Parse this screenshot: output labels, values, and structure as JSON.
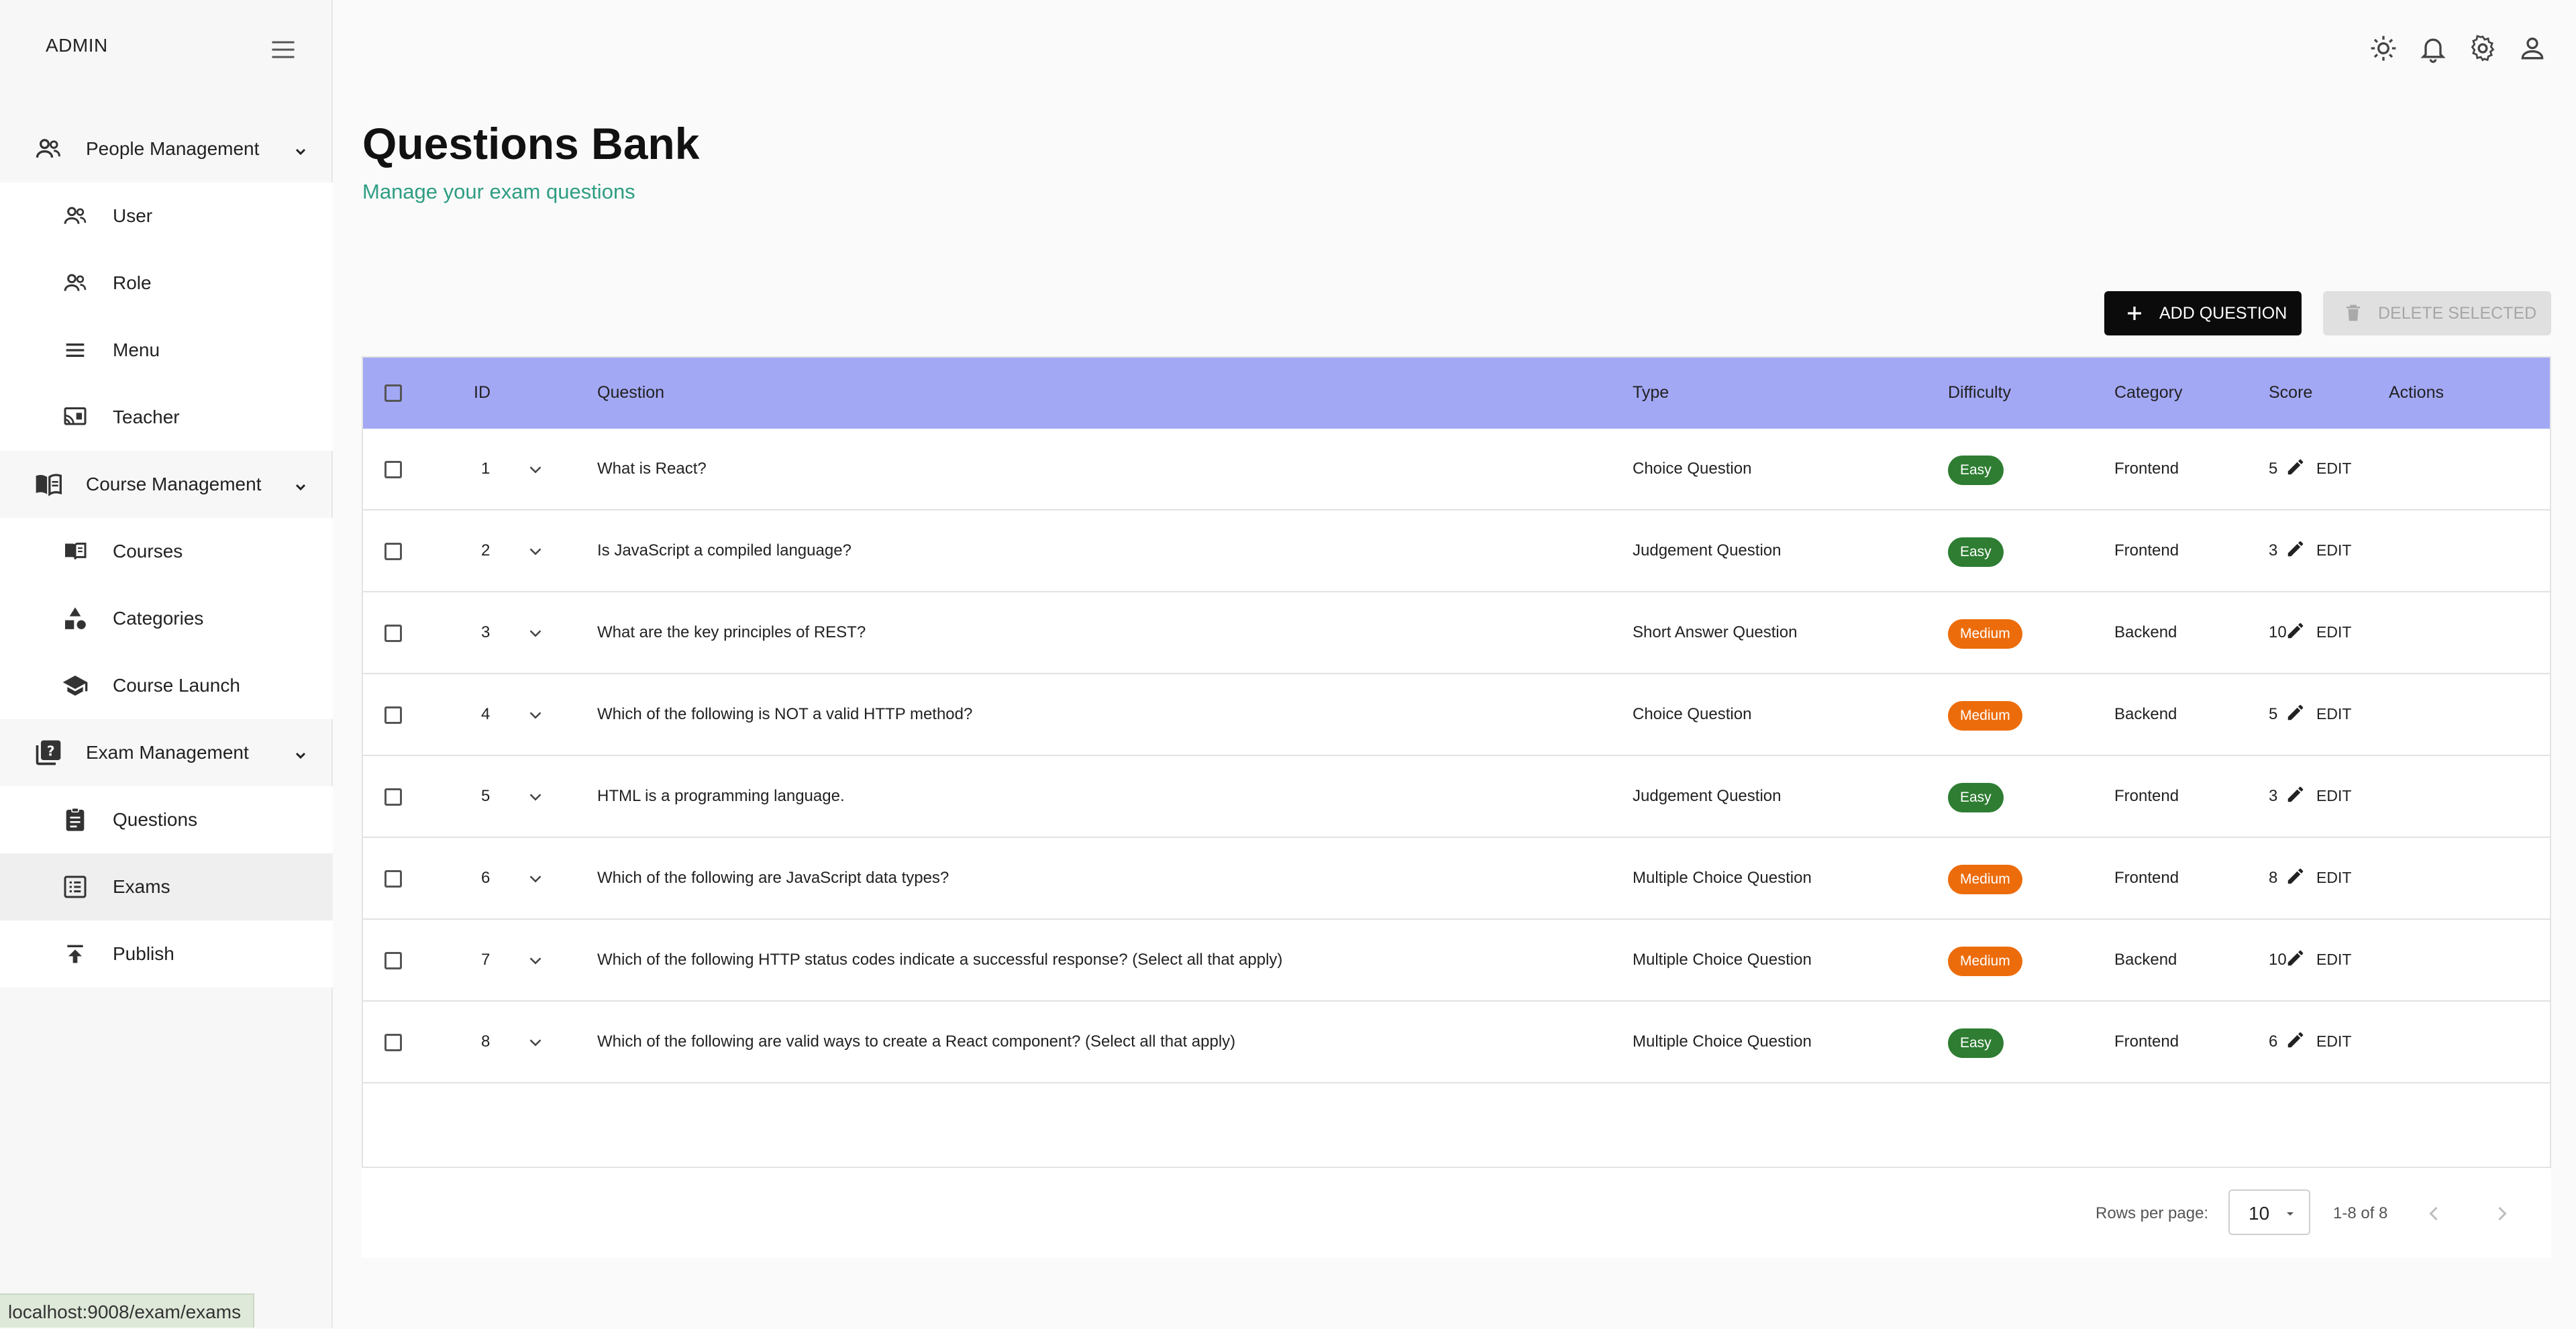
{
  "sidebar": {
    "brand": "ADMIN",
    "groups": [
      {
        "label": "People Management",
        "icon": "people-icon",
        "items": [
          {
            "label": "User",
            "icon": "people-icon"
          },
          {
            "label": "Role",
            "icon": "people-icon"
          },
          {
            "label": "Menu",
            "icon": "menu-lines-icon"
          },
          {
            "label": "Teacher",
            "icon": "cast-for-education-icon"
          }
        ]
      },
      {
        "label": "Course Management",
        "icon": "menu-book-icon",
        "items": [
          {
            "label": "Courses",
            "icon": "book-icon"
          },
          {
            "label": "Categories",
            "icon": "category-shapes-icon"
          },
          {
            "label": "Course Launch",
            "icon": "school-icon"
          }
        ]
      },
      {
        "label": "Exam Management",
        "icon": "quiz-icon",
        "items": [
          {
            "label": "Questions",
            "icon": "assignment-icon"
          },
          {
            "label": "Exams",
            "icon": "list-alt-icon"
          },
          {
            "label": "Publish",
            "icon": "publish-icon"
          }
        ]
      }
    ],
    "active_item": "Exams"
  },
  "topbar": {
    "icons": [
      "theme-sun-icon",
      "notifications-bell-icon",
      "settings-gear-icon",
      "account-person-icon"
    ]
  },
  "header": {
    "title": "Questions Bank",
    "subtitle": "Manage your exam questions"
  },
  "toolbar": {
    "add_label": "ADD QUESTION",
    "delete_label": "DELETE SELECTED"
  },
  "table": {
    "columns": [
      "ID",
      "Question",
      "Type",
      "Difficulty",
      "Category",
      "Score",
      "Actions"
    ],
    "edit_label": "EDIT",
    "rows": [
      {
        "id": "1",
        "question": "What is React?",
        "type": "Choice Question",
        "difficulty": "Easy",
        "category": "Frontend",
        "score": "5"
      },
      {
        "id": "2",
        "question": "Is JavaScript a compiled language?",
        "type": "Judgement Question",
        "difficulty": "Easy",
        "category": "Frontend",
        "score": "3"
      },
      {
        "id": "3",
        "question": "What are the key principles of REST?",
        "type": "Short Answer Question",
        "difficulty": "Medium",
        "category": "Backend",
        "score": "10"
      },
      {
        "id": "4",
        "question": "Which of the following is NOT a valid HTTP method?",
        "type": "Choice Question",
        "difficulty": "Medium",
        "category": "Backend",
        "score": "5"
      },
      {
        "id": "5",
        "question": "HTML is a programming language.",
        "type": "Judgement Question",
        "difficulty": "Easy",
        "category": "Frontend",
        "score": "3"
      },
      {
        "id": "6",
        "question": "Which of the following are JavaScript data types?",
        "type": "Multiple Choice Question",
        "difficulty": "Medium",
        "category": "Frontend",
        "score": "8"
      },
      {
        "id": "7",
        "question": "Which of the following HTTP status codes indicate a successful response? (Select all that apply)",
        "type": "Multiple Choice Question",
        "difficulty": "Medium",
        "category": "Backend",
        "score": "10"
      },
      {
        "id": "8",
        "question": "Which of the following are valid ways to create a React component? (Select all that apply)",
        "type": "Multiple Choice Question",
        "difficulty": "Easy",
        "category": "Frontend",
        "score": "6"
      }
    ]
  },
  "pagination": {
    "rows_per_page_label": "Rows per page:",
    "rows_per_page_value": "10",
    "range_text": "1-8 of 8"
  },
  "status_bar": {
    "url": "localhost:9008/exam/exams"
  },
  "colors": {
    "table_header": "#a3a8f5",
    "easy_badge": "#2e7d32",
    "medium_badge": "#ec6c0b",
    "subtitle": "#2e9d83",
    "primary_button": "#0b0b0b"
  }
}
